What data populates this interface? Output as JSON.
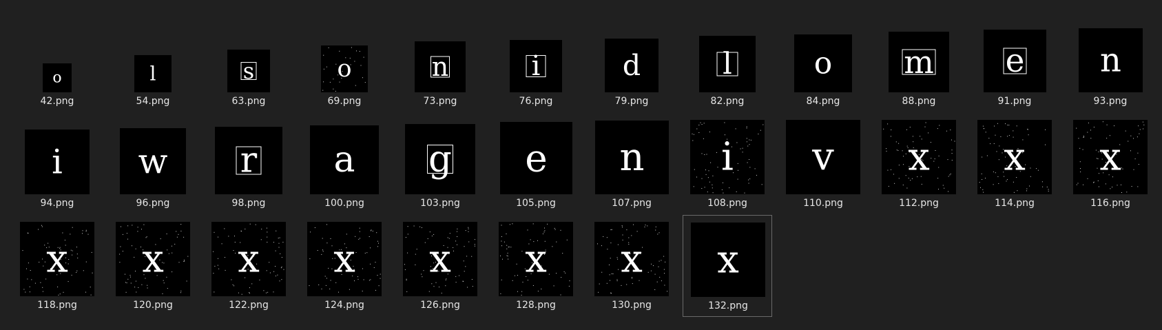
{
  "files": [
    {
      "name": "42.png",
      "glyph": "o",
      "boxed": false,
      "dots": false
    },
    {
      "name": "54.png",
      "glyph": "l",
      "boxed": false,
      "dots": false
    },
    {
      "name": "63.png",
      "glyph": "s",
      "boxed": true,
      "dots": false
    },
    {
      "name": "69.png",
      "glyph": "o",
      "boxed": false,
      "dots": true
    },
    {
      "name": "73.png",
      "glyph": "n",
      "boxed": true,
      "dots": false
    },
    {
      "name": "76.png",
      "glyph": "i",
      "boxed": true,
      "dots": false
    },
    {
      "name": "79.png",
      "glyph": "d",
      "boxed": false,
      "dots": false
    },
    {
      "name": "82.png",
      "glyph": "l",
      "boxed": true,
      "dots": false
    },
    {
      "name": "84.png",
      "glyph": "o",
      "boxed": false,
      "dots": false
    },
    {
      "name": "88.png",
      "glyph": "m",
      "boxed": true,
      "dots": false
    },
    {
      "name": "91.png",
      "glyph": "e",
      "boxed": true,
      "dots": false
    },
    {
      "name": "93.png",
      "glyph": "n",
      "boxed": false,
      "dots": false
    },
    {
      "name": "94.png",
      "glyph": "i",
      "boxed": false,
      "dots": false
    },
    {
      "name": "96.png",
      "glyph": "w",
      "boxed": false,
      "dots": false
    },
    {
      "name": "98.png",
      "glyph": "r",
      "boxed": true,
      "dots": false
    },
    {
      "name": "100.png",
      "glyph": "a",
      "boxed": false,
      "dots": false
    },
    {
      "name": "103.png",
      "glyph": "g",
      "boxed": true,
      "dots": false
    },
    {
      "name": "105.png",
      "glyph": "e",
      "boxed": false,
      "dots": false
    },
    {
      "name": "107.png",
      "glyph": "n",
      "boxed": false,
      "dots": false
    },
    {
      "name": "108.png",
      "glyph": "i",
      "boxed": false,
      "dots": true
    },
    {
      "name": "110.png",
      "glyph": "v",
      "boxed": false,
      "dots": false
    },
    {
      "name": "112.png",
      "glyph": "x",
      "boxed": false,
      "dots": true
    },
    {
      "name": "114.png",
      "glyph": "x",
      "boxed": false,
      "dots": true
    },
    {
      "name": "116.png",
      "glyph": "x",
      "boxed": false,
      "dots": true
    },
    {
      "name": "118.png",
      "glyph": "x",
      "boxed": false,
      "dots": true
    },
    {
      "name": "120.png",
      "glyph": "x",
      "boxed": false,
      "dots": true
    },
    {
      "name": "122.png",
      "glyph": "x",
      "boxed": false,
      "dots": true
    },
    {
      "name": "124.png",
      "glyph": "x",
      "boxed": false,
      "dots": true
    },
    {
      "name": "126.png",
      "glyph": "x",
      "boxed": false,
      "dots": true
    },
    {
      "name": "128.png",
      "glyph": "x",
      "boxed": false,
      "dots": true
    },
    {
      "name": "130.png",
      "glyph": "x",
      "boxed": false,
      "dots": true
    },
    {
      "name": "132.png",
      "glyph": "x",
      "boxed": false,
      "dots": false
    }
  ],
  "selected_file": "132.png"
}
